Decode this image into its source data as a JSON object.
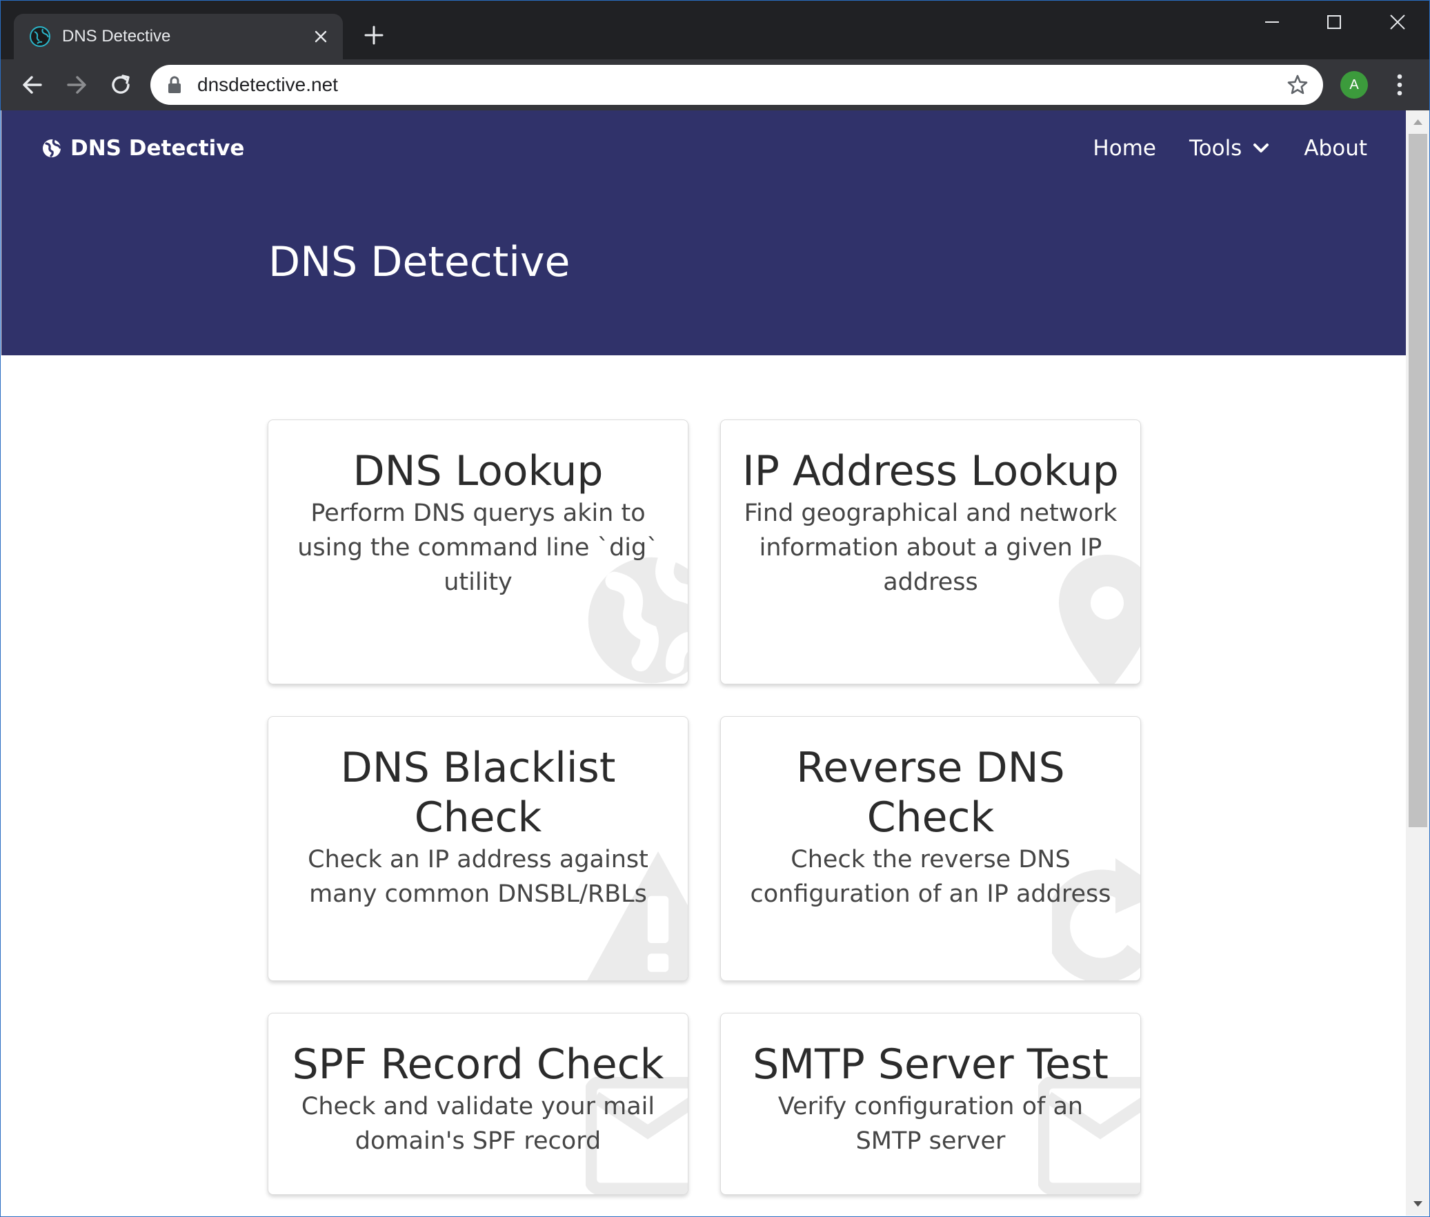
{
  "browser": {
    "tab_title": "DNS Detective",
    "url": "dnsdetective.net",
    "profile_initial": "A",
    "accent": "#202124"
  },
  "navbar": {
    "brand": "DNS Detective",
    "links": [
      "Home",
      "Tools",
      "About"
    ],
    "background": "#30326a"
  },
  "hero": {
    "title": "DNS Detective"
  },
  "cards": [
    {
      "title": "DNS Lookup",
      "description": "Perform DNS querys akin to using the command line `dig` utility",
      "icon": "globe-icon"
    },
    {
      "title": "IP Address Lookup",
      "description": "Find geographical and network information about a given IP address",
      "icon": "map-marker-icon"
    },
    {
      "title": "DNS Blacklist Check",
      "description": "Check an IP address against many common DNSBL/RBLs",
      "icon": "warning-icon"
    },
    {
      "title": "Reverse DNS Check",
      "description": "Check the reverse DNS configuration of an IP address",
      "icon": "redo-icon"
    },
    {
      "title": "SPF Record Check",
      "description": "Check and validate your mail domain's SPF record",
      "icon": "envelope-icon"
    },
    {
      "title": "SMTP Server Test",
      "description": "Verify configuration of an SMTP server",
      "icon": "envelope-icon"
    }
  ]
}
